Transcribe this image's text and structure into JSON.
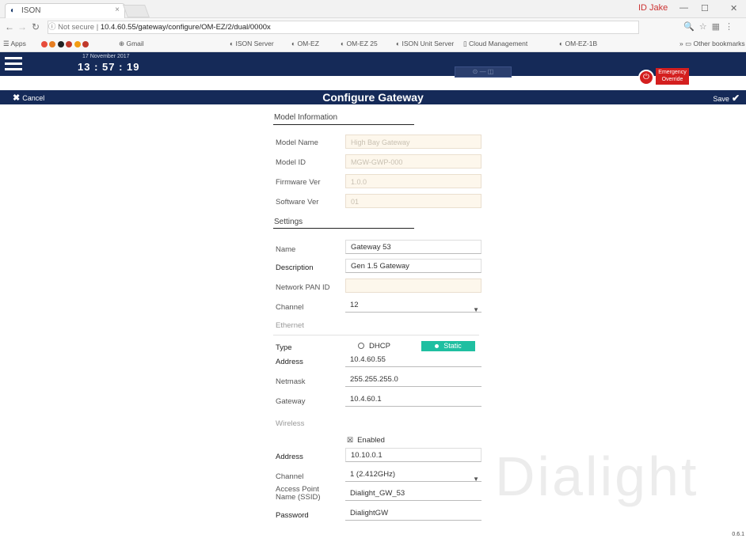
{
  "browser": {
    "tab_title": "ISON",
    "url_prefix": "ⓘ Not secure",
    "url": "10.4.60.55/gateway/configure/OM-EZ/2/dual/0000x",
    "user": "ID Jake",
    "bookmarks": [
      {
        "label": "Apps"
      },
      {
        "label": "Gmail"
      },
      {
        "label": "ISON Server"
      },
      {
        "label": "OM-EZ"
      },
      {
        "label": "OM-EZ 25"
      },
      {
        "label": "ISON Unit Server"
      },
      {
        "label": "Cloud Management"
      },
      {
        "label": "OM-EZ-1B"
      },
      {
        "label": "Other bookmarks"
      }
    ]
  },
  "header": {
    "date": "17 November 2017",
    "time": "13 : 57 : 19",
    "center_widget": "⊙ — ◫",
    "emergency_line1": "Emergency",
    "emergency_line2": "Override"
  },
  "subbar": {
    "cancel_label": "Cancel",
    "title": "Configure Gateway",
    "save_label": "Save"
  },
  "model_info": {
    "section_title": "Model Information",
    "model_name_label": "Model Name",
    "model_name_value": "High Bay Gateway",
    "model_id_label": "Model ID",
    "model_id_value": "MGW-GWP-000",
    "firmware_label": "Firmware Ver",
    "firmware_value": "1.0.0",
    "software_label": "Software Ver",
    "software_value": "01"
  },
  "settings": {
    "section_title": "Settings",
    "name_label": "Name",
    "name_value": "Gateway 53",
    "description_label": "Description",
    "description_value": "Gen 1.5 Gateway",
    "network_label": "Network PAN ID",
    "network_value": "",
    "channel_label": "Channel",
    "channel_value": "12"
  },
  "ethernet": {
    "title": "Ethernet",
    "type_label": "Type",
    "dhcp_label": "DHCP",
    "static_label": "Static",
    "address_label": "Address",
    "address_value": "10.4.60.55",
    "netmask_label": "Netmask",
    "netmask_value": "255.255.255.0",
    "gateway_label": "Gateway",
    "gateway_value": "10.4.60.1"
  },
  "wireless": {
    "title": "Wireless",
    "enabled_label": "Enabled",
    "address_label": "Address",
    "address_value": "10.10.0.1",
    "channel_label": "Channel",
    "channel_value": "1 (2.412GHz)",
    "ssid_label_1": "Access Point",
    "ssid_label_2": "Name (SSID)",
    "ssid_value": "Dialight_GW_53",
    "password_label": "Password",
    "password_value": "DialightGW"
  },
  "watermark": "Dialight",
  "corner_text": "0.6.1"
}
